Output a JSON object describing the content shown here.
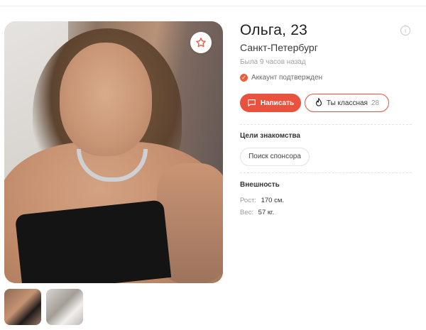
{
  "profile": {
    "name_age": "Ольга, 23",
    "city": "Санкт-Петербург",
    "last_seen": "Была 9 часов назад",
    "verified_label": "Аккаунт подтвержден"
  },
  "actions": {
    "write_label": "Написать",
    "like_label": "Ты классная",
    "like_count": "28"
  },
  "goals": {
    "title": "Цели знакомства",
    "items": [
      "Поиск спонсора"
    ]
  },
  "appearance": {
    "title": "Внешность",
    "height_label": "Рост:",
    "height_value": "170 см.",
    "weight_label": "Вес:",
    "weight_value": "57 кг."
  },
  "icons": {
    "favorite": "star-outline-icon",
    "info": "info-icon",
    "verified": "check-circle-icon",
    "message": "chat-bubble-icon",
    "like": "flame-icon"
  },
  "colors": {
    "accent": "#e9523e"
  }
}
